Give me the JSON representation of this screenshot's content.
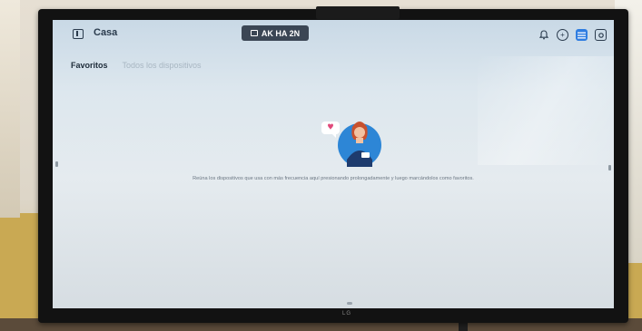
{
  "app": {
    "title": "Casa",
    "device_name": "AK HA 2N"
  },
  "header_actions": [
    {
      "name": "notifications",
      "icon": "bell-icon"
    },
    {
      "name": "add",
      "icon": "plus-icon"
    },
    {
      "name": "list-view",
      "icon": "list-icon",
      "active": true
    },
    {
      "name": "settings",
      "icon": "gear-icon"
    }
  ],
  "tabs": {
    "favorites": "Favoritos",
    "all_devices": "Todos los dispositivos"
  },
  "empty_state": {
    "message": "Reúna los dispositivos que usa con más frecuencia aquí presionando prolongadamente y luego marcándolos como favoritos."
  },
  "tv": {
    "brand": "LG"
  },
  "colors": {
    "accent": "#2f7de1",
    "text_dark": "#1e2c3a",
    "tab_inactive": "#a8b6c2",
    "pill_bg": "#3b4654"
  }
}
